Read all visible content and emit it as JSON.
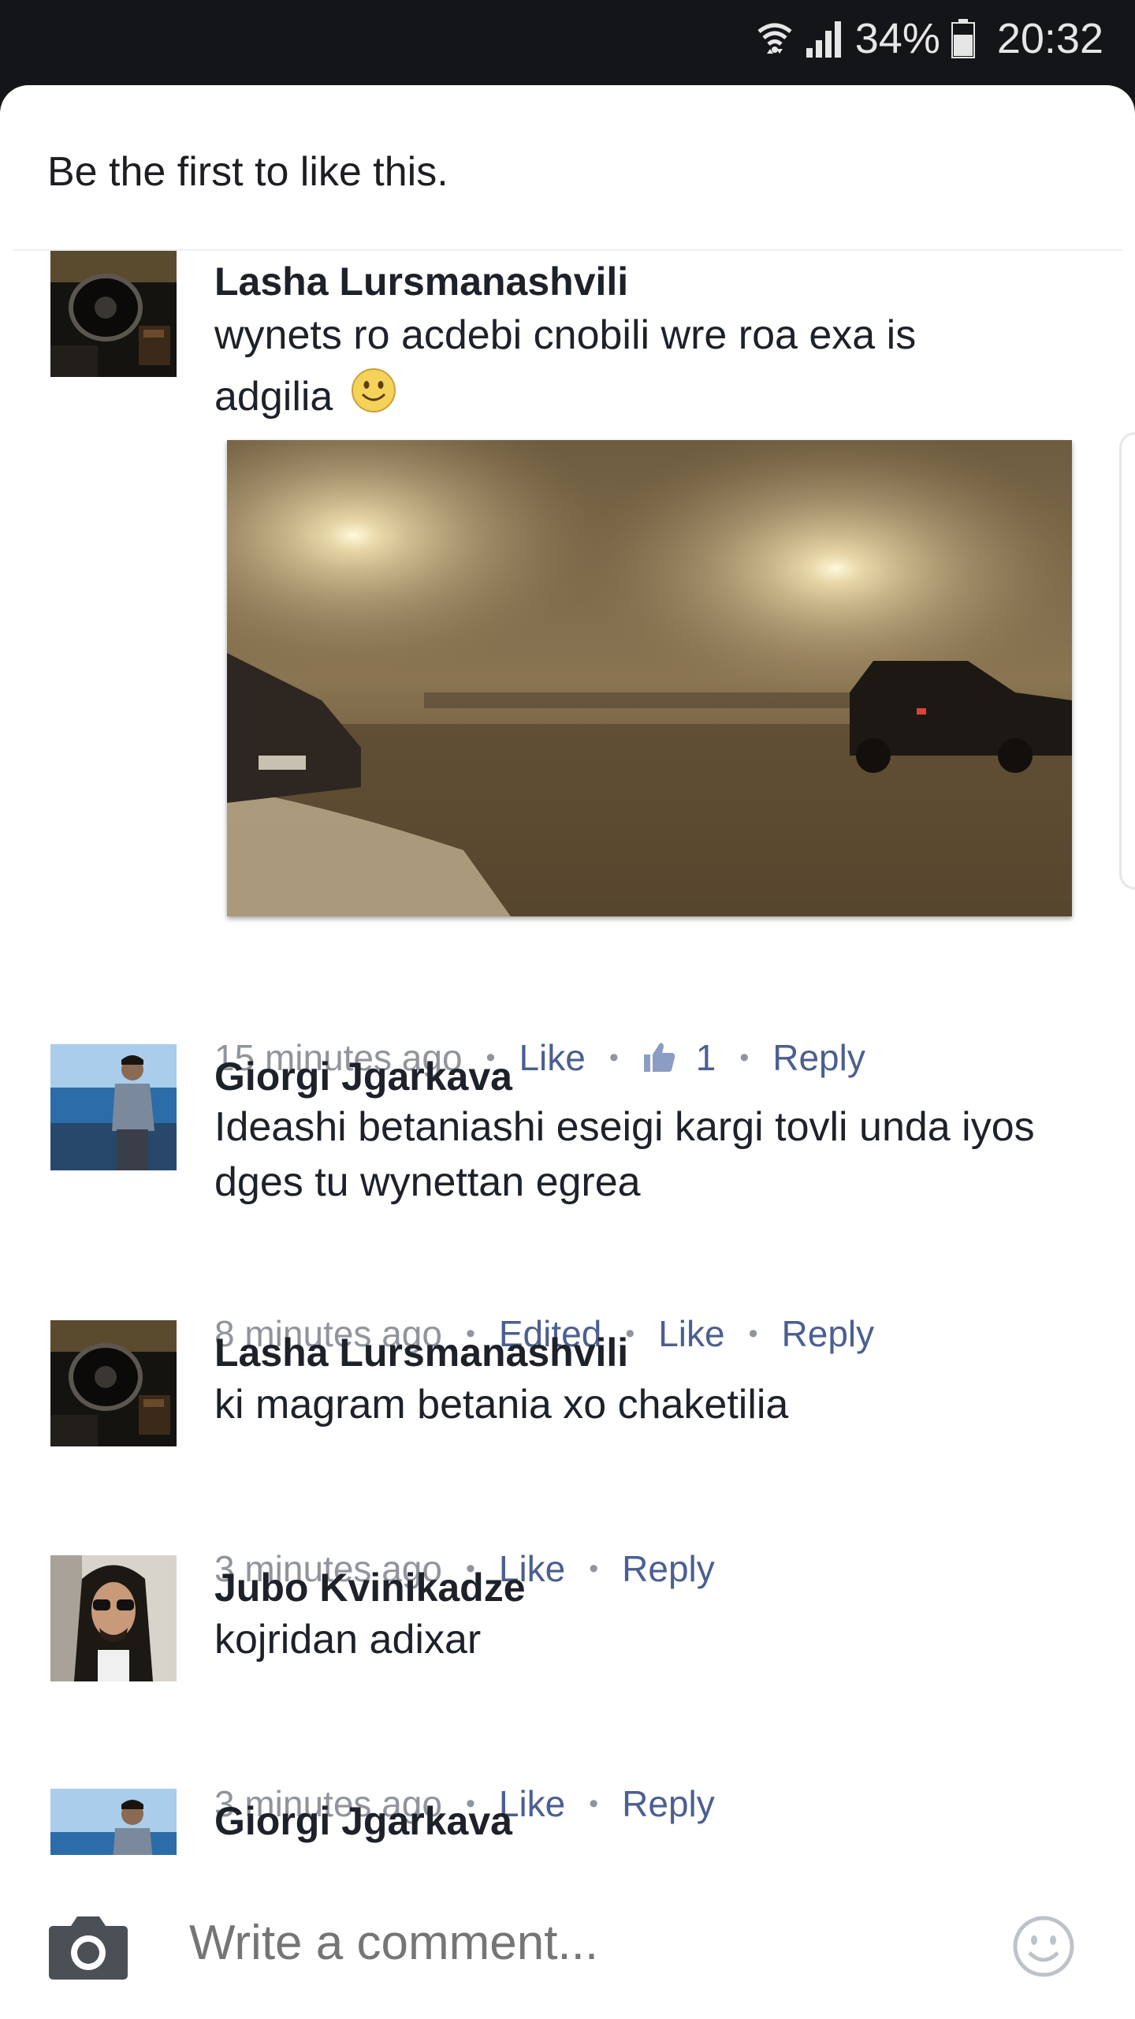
{
  "status_bar": {
    "battery": "34%",
    "time": "20:32",
    "icons": [
      "wifi-icon",
      "signal-icon",
      "battery-icon"
    ]
  },
  "likes_summary": "Be the first to like this.",
  "comments": [
    {
      "author": "Lasha Lursmanashvili",
      "text": "wynets ro acdebi cnobili wre roa exa is adgilia",
      "emoji": "smiley-emoji",
      "has_photo": true,
      "time": "15 minutes ago",
      "like": "Like",
      "like_count": "1",
      "reply": "Reply"
    },
    {
      "author": "Giorgi Jgarkava",
      "text": "Ideashi betaniashi eseigi kargi tovli unda iyos dges tu wynettan egrea",
      "time": "8 minutes ago",
      "edited": "Edited",
      "like": "Like",
      "reply": "Reply"
    },
    {
      "author": "Lasha Lursmanashvili",
      "text": "ki magram betania xo chaketilia",
      "time": "3 minutes ago",
      "like": "Like",
      "reply": "Reply"
    },
    {
      "author": "Jubo Kvinikadze",
      "text": "kojridan adixar",
      "time": "3 minutes ago",
      "like": "Like",
      "reply": "Reply"
    },
    {
      "author": "Giorgi Jgarkava"
    }
  ],
  "composer": {
    "placeholder": "Write a comment..."
  },
  "colors": {
    "link": "#4b5f90",
    "meta_gray": "#90949c",
    "text": "#1d2129",
    "status_bar_bg": "#141518"
  }
}
